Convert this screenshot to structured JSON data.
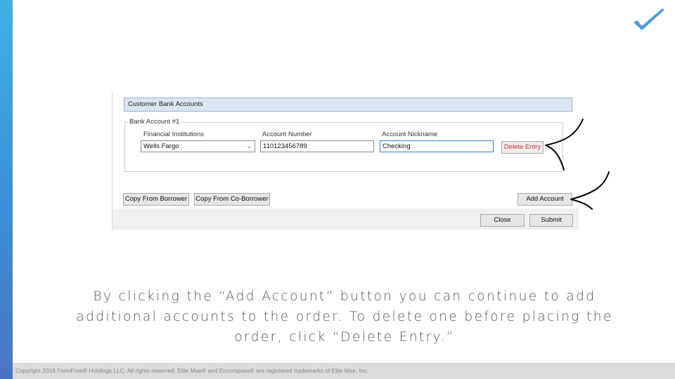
{
  "dialog": {
    "panel_title": "Customer Bank Accounts",
    "group_title": "Bank Account #1",
    "fields": {
      "institution_label": "Financial Institutions",
      "institution_value": "Wells Fargo",
      "account_number_label": "Account Number",
      "account_number_value": "110123456789",
      "nickname_label": "Account Nickname",
      "nickname_value": "Checking"
    },
    "buttons": {
      "delete_entry": "Delete Entry",
      "copy_from_borrower": "Copy From Borrower",
      "copy_from_coborrower": "Copy From Co-Borrower",
      "add_account": "Add Account",
      "close": "Close",
      "submit": "Submit"
    }
  },
  "caption": {
    "line1": "By clicking the “Add Account” button you can continue to add",
    "line2": "additional accounts to the order. To delete one before placing the",
    "line3": "order, click “Delete Entry.”"
  },
  "footer": {
    "copyright": "Copyright 2018 FormFree® Holdings LLC. All rights reserved. Ellie Mae® and Encompass® are registered trademarks of Ellie Mae, Inc."
  },
  "colors": {
    "accent_bar": "#3a8fd8",
    "logo_check": "#4a9de0",
    "delete_text": "#d23030"
  },
  "icons": {
    "logo": "checkmark-icon",
    "dropdown": "chevron-down-icon"
  }
}
